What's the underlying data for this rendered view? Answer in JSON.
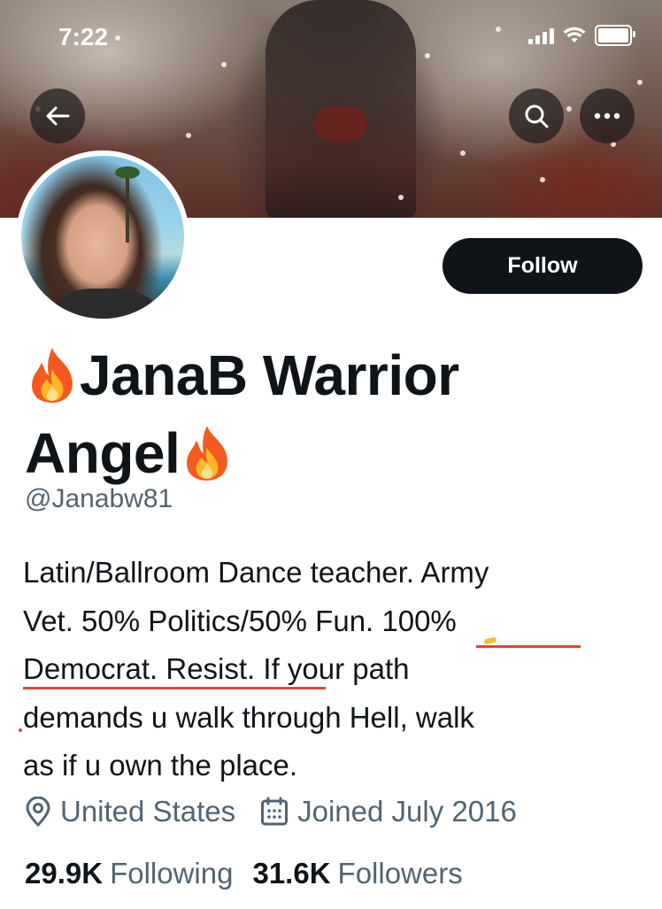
{
  "status_bar": {
    "time": "7:22"
  },
  "profile": {
    "follow_label": "Follow",
    "name_line1": "JanaB Warrior",
    "name_line2": "Angel",
    "handle": "@Janabw81",
    "bio_lines": [
      "Latin/Ballroom Dance teacher. Army",
      "Vet. 50% Politics/50% Fun. 100%",
      "Democrat. Resist. If your path",
      "demands u walk through Hell, walk",
      "as if u own the place."
    ],
    "location": "United States",
    "joined": "Joined July 2016",
    "following_count": "29.9K",
    "following_label": "Following",
    "followers_count": "31.6K",
    "followers_label": "Followers"
  },
  "icons": {
    "back": "arrow-left-icon",
    "search": "search-icon",
    "more": "more-icon",
    "location": "location-pin-icon",
    "calendar": "calendar-icon",
    "flame": "fire-emoji-icon"
  },
  "colors": {
    "text_primary": "#0f1419",
    "text_secondary": "#536471",
    "follow_bg": "#0f1419",
    "annotation_red": "#e0463a"
  }
}
